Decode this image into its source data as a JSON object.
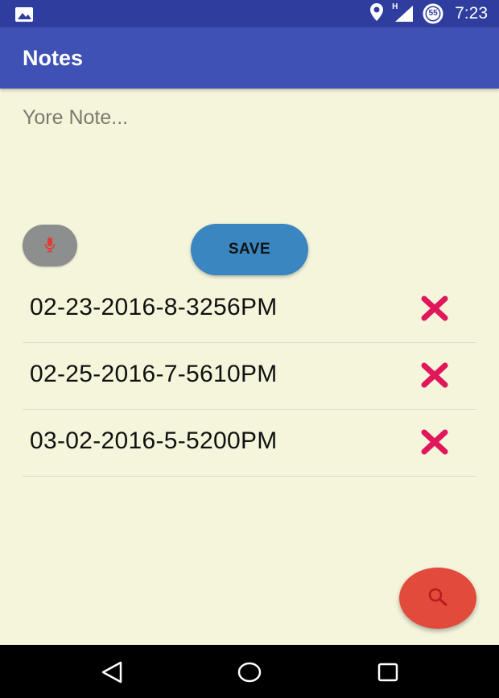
{
  "status_bar": {
    "time": "7:23",
    "network_label": "H",
    "notification_count": "55",
    "icons": [
      "image-notification-icon",
      "location-icon",
      "signal-icon",
      "data-saver-icon"
    ]
  },
  "app_bar": {
    "title": "Notes"
  },
  "note_input": {
    "placeholder": "Yore Note...",
    "value": ""
  },
  "buttons": {
    "save_label": "SAVE"
  },
  "notes": [
    {
      "label": "02-23-2016-8-3256PM"
    },
    {
      "label": "02-25-2016-7-5610PM"
    },
    {
      "label": "03-02-2016-5-5200PM"
    }
  ],
  "colors": {
    "app_bar": "#3f51b5",
    "status_bar": "#2f3e9e",
    "background": "#f5f5dc",
    "save_button": "#3a86c0",
    "mic_button": "#8c8f8d",
    "delete_icon": "#e0175a",
    "fab": "#e24a3b"
  }
}
